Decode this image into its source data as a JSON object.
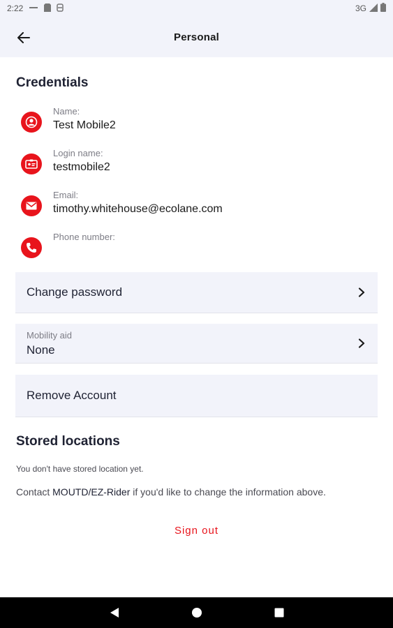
{
  "status_bar": {
    "time": "2:22",
    "network": "3G"
  },
  "app_bar": {
    "title": "Personal",
    "back_icon": "arrow-left-icon"
  },
  "credentials": {
    "title": "Credentials",
    "items": [
      {
        "label": "Name:",
        "value": "Test Mobile2",
        "icon": "person-icon"
      },
      {
        "label": "Login name:",
        "value": "testmobile2",
        "icon": "id-card-icon"
      },
      {
        "label": "Email:",
        "value": "timothy.whitehouse@ecolane.com",
        "icon": "mail-icon"
      },
      {
        "label": "Phone number:",
        "value": "",
        "icon": "phone-icon"
      }
    ]
  },
  "actions": {
    "change_password": "Change password",
    "mobility_aid_label": "Mobility aid",
    "mobility_aid_value": "None",
    "remove_account": "Remove Account"
  },
  "stored_locations": {
    "title": "Stored locations",
    "empty_text": "You don't have stored location yet."
  },
  "contact": {
    "prefix": "Contact",
    "agency": "MOUTD/EZ-Rider",
    "suffix": "if you'd like to change the information above."
  },
  "sign_out": "Sign out",
  "colors": {
    "accent": "#e8141c",
    "surface": "#f2f3fa",
    "nav_bar": "#000000"
  }
}
